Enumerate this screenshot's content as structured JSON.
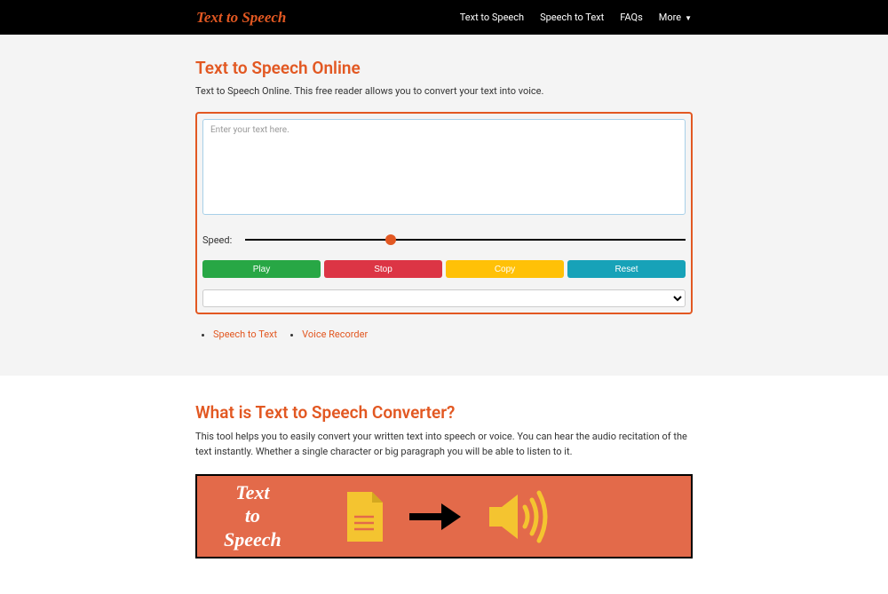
{
  "nav": {
    "brand": "Text to Speech",
    "items": [
      "Text to Speech",
      "Speech to Text",
      "FAQs"
    ],
    "more": "More"
  },
  "hero": {
    "title": "Text to Speech Online",
    "subtitle": "Text to Speech Online. This free reader allows you to convert your text into voice."
  },
  "panel": {
    "placeholder": "Enter your text here.",
    "speed_label": "Speed:",
    "buttons": {
      "play": "Play",
      "stop": "Stop",
      "copy": "Copy",
      "reset": "Reset"
    }
  },
  "links": {
    "stt": "Speech to Text",
    "recorder": "Voice Recorder"
  },
  "what": {
    "title": "What is Text to Speech Converter?",
    "desc": "This tool helps you to easily convert your written text into speech or voice. You can hear the audio recitation of the text instantly. Whether a single character or big paragraph you will be able to listen to it."
  },
  "illustration": {
    "text": "Text to Speech"
  }
}
